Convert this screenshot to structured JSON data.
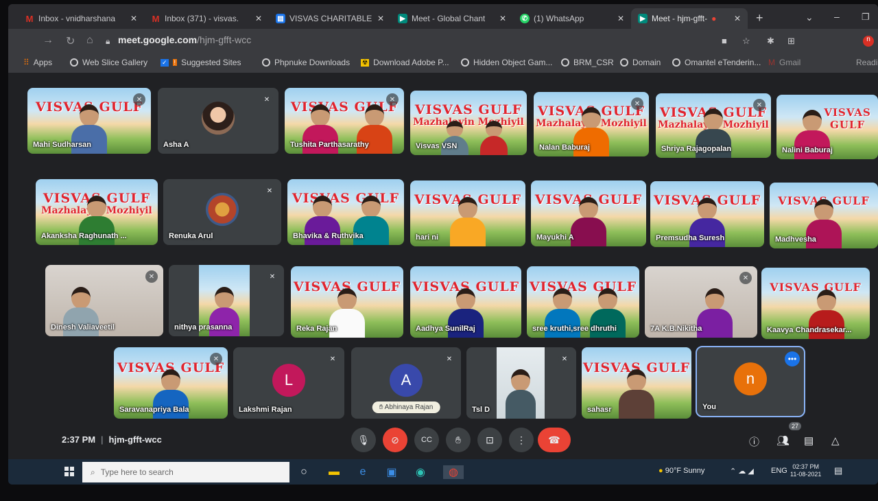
{
  "tabs": [
    {
      "title": "Inbox - vnidharshana",
      "icon": "gmail-icon",
      "icon_text": "M",
      "icon_color": "#d93025"
    },
    {
      "title": "Inbox (371) - visvas.",
      "icon": "gmail-icon",
      "icon_text": "M",
      "icon_color": "#d93025"
    },
    {
      "title": "VISVAS CHARITABLE",
      "icon": "forms-icon",
      "icon_text": "▤",
      "icon_color": "#1a73e8"
    },
    {
      "title": "Meet - Global Chant",
      "icon": "meet-icon",
      "icon_text": "▶",
      "icon_color": "#00897b"
    },
    {
      "title": "(1) WhatsApp",
      "icon": "whatsapp-icon",
      "icon_text": "✆",
      "icon_color": "#25d366"
    },
    {
      "title": "Meet - hjm-gfft-",
      "icon": "meet-icon",
      "icon_text": "▶",
      "icon_color": "#00897b"
    }
  ],
  "address": {
    "domain": "meet.google.com",
    "path": "/hjm-gfft-wcc"
  },
  "bookmarks": [
    "Apps",
    "Web Slice Gallery",
    "Suggested Sites",
    "Phpnuke Downloads",
    "Download Adobe P...",
    "Hidden Object Gam...",
    "BRM_CSR",
    "Domain",
    "Omantel eTenderin...",
    "Gmail",
    "Readin"
  ],
  "banner": {
    "line1": "VISVAS GULF",
    "line2": "Mazhalayin Mozhiyil"
  },
  "participants": [
    {
      "name": "Mahi Sudharsan"
    },
    {
      "name": "Asha A"
    },
    {
      "name": "Tushita Parthasarathy"
    },
    {
      "name": "Visvas VSN"
    },
    {
      "name": "Nalan Baburaj"
    },
    {
      "name": "Shriya Rajagopalan"
    },
    {
      "name": "Nalini Baburaj"
    },
    {
      "name": "Akanksha Raghunath ..."
    },
    {
      "name": "Renuka Arul"
    },
    {
      "name": "Bhavika & Ruthvika"
    },
    {
      "name": "hari ni"
    },
    {
      "name": "Mayukhi A"
    },
    {
      "name": "Premsudha Suresh"
    },
    {
      "name": "Madhvesha"
    },
    {
      "name": "Dinesh Valiaveetil"
    },
    {
      "name": "nithya prasanna"
    },
    {
      "name": "Reka Rajan"
    },
    {
      "name": "Aadhya SunilRaj"
    },
    {
      "name": "sree kruthi,sree dhruthi"
    },
    {
      "name": "7A K.B.Nikitha"
    },
    {
      "name": "Kaavya Chandrasekar..."
    },
    {
      "name": "Saravanapriya Bala"
    },
    {
      "name": "Lakshmi Rajan",
      "initial": "L",
      "color": "#c2185b"
    },
    {
      "name": "Abhinaya Rajan",
      "initial": "A",
      "color": "#3949ab"
    },
    {
      "name": "Tsl D"
    },
    {
      "name": "sahasr"
    },
    {
      "name": "You",
      "initial": "n",
      "color": "#e8710a"
    }
  ],
  "meeting": {
    "time": "2:37 PM",
    "code": "hjm-gfft-wcc",
    "people_count": "27"
  },
  "taskbar": {
    "search_placeholder": "Type here to search",
    "weather": "90°F  Sunny",
    "lang": "ENG",
    "time": "02:37 PM",
    "date": "11-08-2021"
  }
}
